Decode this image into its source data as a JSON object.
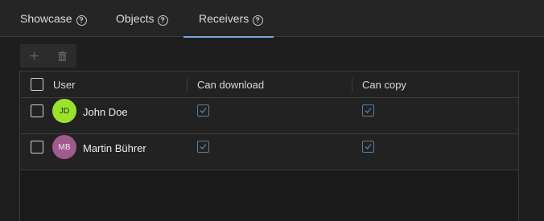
{
  "tabs": [
    {
      "label": "Showcase"
    },
    {
      "label": "Objects"
    },
    {
      "label": "Receivers"
    }
  ],
  "active_tab": "Receivers",
  "toolbar": {
    "add_icon": "plus-icon",
    "delete_icon": "trash-icon"
  },
  "grid": {
    "columns": {
      "user": "User",
      "can_download": "Can download",
      "can_copy": "Can copy"
    },
    "rows": [
      {
        "initials": "JD",
        "name": "John Doe",
        "avatar_color": "#9be22d",
        "can_download": true,
        "can_copy": true
      },
      {
        "initials": "MB",
        "name": "Martin Bührer",
        "avatar_color": "#a05a8c",
        "can_download": true,
        "can_copy": true
      }
    ]
  },
  "colors": {
    "accent": "#7aa3d9",
    "checked_permission": "#5c7ea0"
  }
}
